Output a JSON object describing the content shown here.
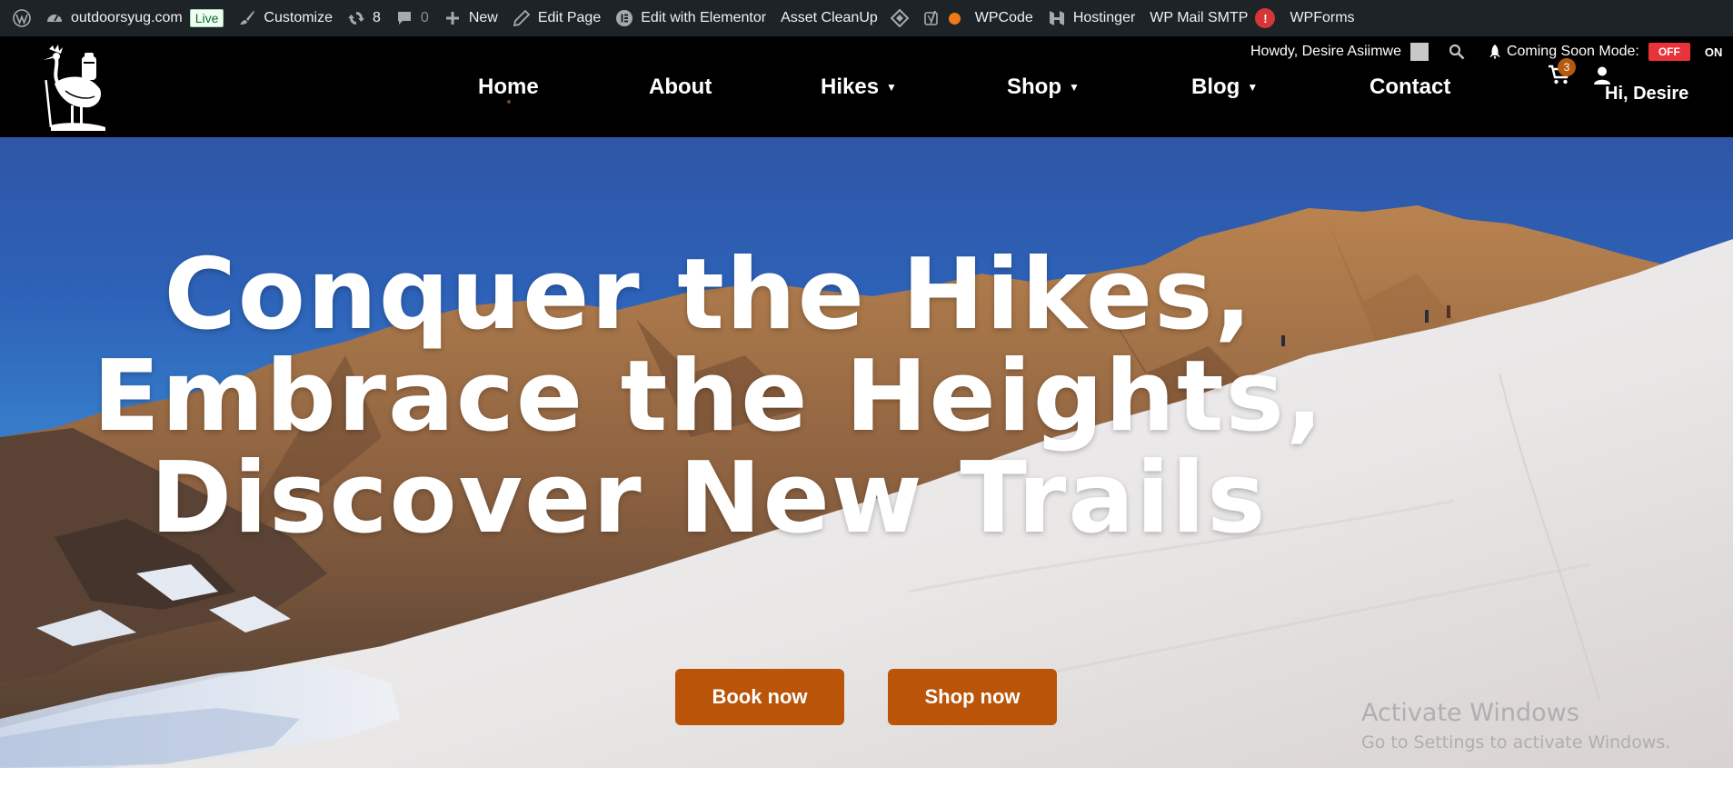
{
  "admin_bar": {
    "site_name": "outdoorsyug.com",
    "live_badge": "Live",
    "customize": "Customize",
    "updates_count": "8",
    "comments_count": "0",
    "new": "New",
    "edit_page": "Edit Page",
    "edit_elementor": "Edit with Elementor",
    "asset_cleanup": "Asset CleanUp",
    "wpcode": "WPCode",
    "hostinger": "Hostinger",
    "wp_mail_smtp": "WP Mail SMTP",
    "smtp_alert": "!",
    "wpforms": "WPForms"
  },
  "header": {
    "howdy": "Howdy, Desire Asiimwe",
    "coming_soon_label": "Coming Soon Mode:",
    "coming_soon_off": "OFF",
    "coming_soon_on": "ON",
    "cart_count": "3",
    "user_greeting": "Hi, Desire"
  },
  "nav": {
    "home": "Home",
    "about": "About",
    "hikes": "Hikes",
    "shop": "Shop",
    "blog": "Blog",
    "contact": "Contact"
  },
  "hero": {
    "line1": "Conquer the Hikes,",
    "line2": "Embrace the Heights,",
    "line3": "Discover New Trails",
    "book_button": "Book now",
    "shop_button": "Shop now"
  },
  "watermark": {
    "title": "Activate Windows",
    "subtitle": "Go to Settings to activate Windows."
  },
  "colors": {
    "admin_bar_bg": "#1d2327",
    "header_bg": "#000000",
    "cta": "#b95408",
    "off_badge": "#e8333a"
  }
}
